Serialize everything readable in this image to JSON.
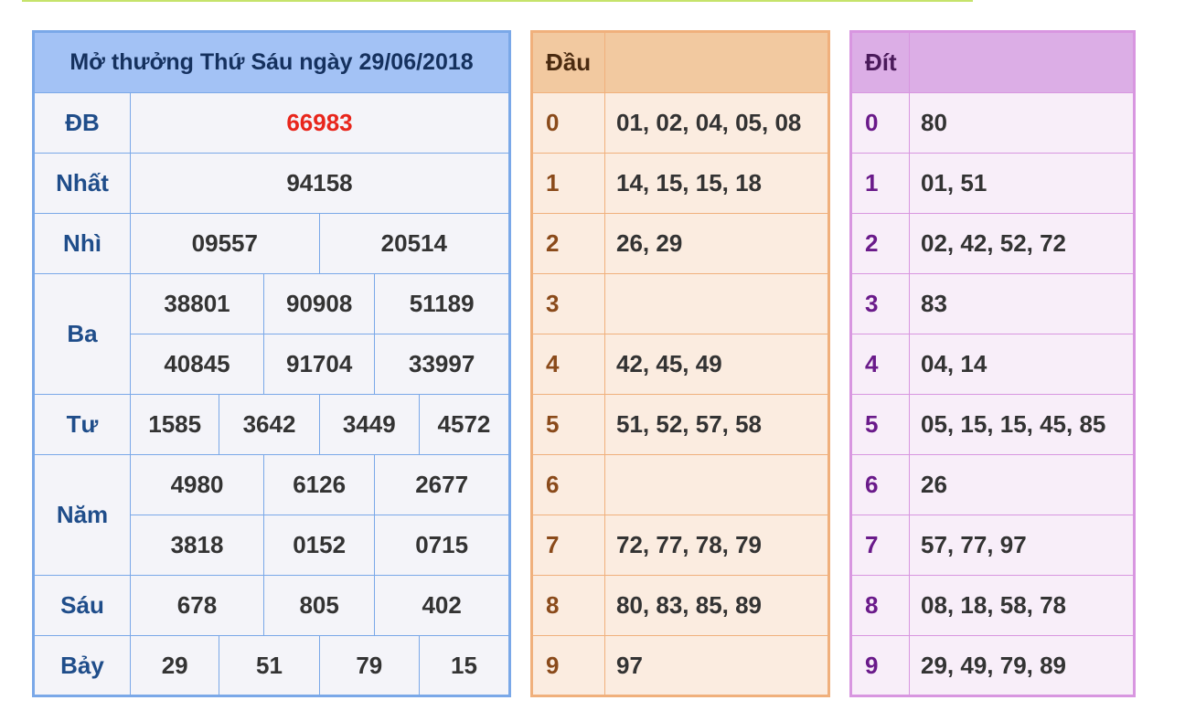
{
  "results": {
    "title": "Mở thưởng Thứ Sáu ngày 29/06/2018",
    "db_label": "ĐB",
    "db": "66983",
    "nhat_label": "Nhất",
    "nhat": "94158",
    "nhi_label": "Nhì",
    "nhi": [
      "09557",
      "20514"
    ],
    "ba_label": "Ba",
    "ba": [
      "38801",
      "90908",
      "51189",
      "40845",
      "91704",
      "33997"
    ],
    "tu_label": "Tư",
    "tu": [
      "1585",
      "3642",
      "3449",
      "4572"
    ],
    "nam_label": "Năm",
    "nam": [
      "4980",
      "6126",
      "2677",
      "3818",
      "0152",
      "0715"
    ],
    "sau_label": "Sáu",
    "sau": [
      "678",
      "805",
      "402"
    ],
    "bay_label": "Bảy",
    "bay": [
      "29",
      "51",
      "79",
      "15"
    ]
  },
  "dau": {
    "header": "Đầu",
    "rows": [
      {
        "num": "0",
        "val": "01, 02, 04, 05, 08"
      },
      {
        "num": "1",
        "val": "14, 15, 15, 18"
      },
      {
        "num": "2",
        "val": "26, 29"
      },
      {
        "num": "3",
        "val": ""
      },
      {
        "num": "4",
        "val": "42, 45, 49"
      },
      {
        "num": "5",
        "val": "51, 52, 57, 58"
      },
      {
        "num": "6",
        "val": ""
      },
      {
        "num": "7",
        "val": "72, 77, 78, 79"
      },
      {
        "num": "8",
        "val": "80, 83, 85, 89"
      },
      {
        "num": "9",
        "val": "97"
      }
    ]
  },
  "dit": {
    "header": "Đít",
    "rows": [
      {
        "num": "0",
        "val": "80"
      },
      {
        "num": "1",
        "val": "01, 51"
      },
      {
        "num": "2",
        "val": "02, 42, 52, 72"
      },
      {
        "num": "3",
        "val": "83"
      },
      {
        "num": "4",
        "val": "04, 14"
      },
      {
        "num": "5",
        "val": "05, 15, 15, 45, 85"
      },
      {
        "num": "6",
        "val": "26"
      },
      {
        "num": "7",
        "val": "57, 77, 97"
      },
      {
        "num": "8",
        "val": "08, 18, 58, 78"
      },
      {
        "num": "9",
        "val": "29, 49, 79, 89"
      }
    ]
  }
}
